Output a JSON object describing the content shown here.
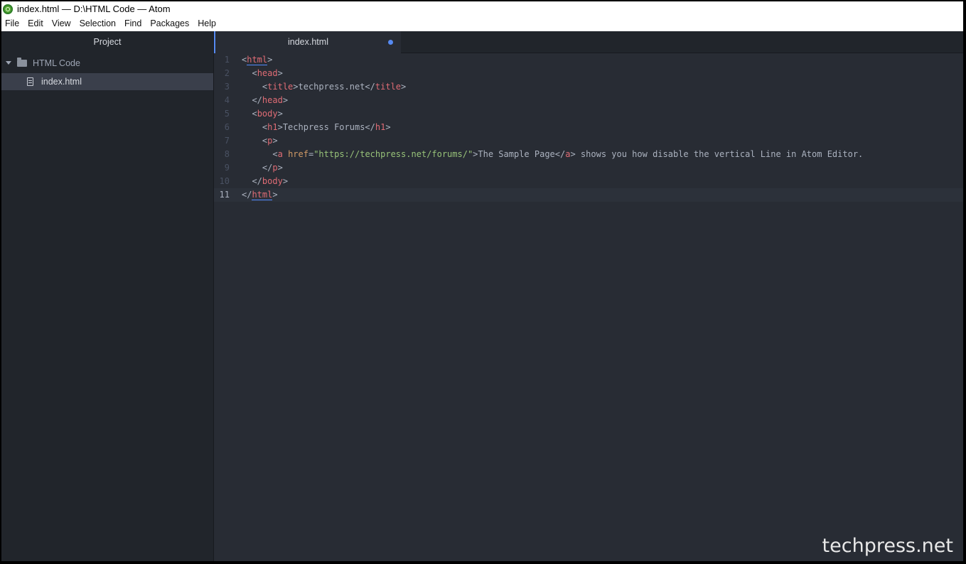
{
  "titlebar": {
    "title": "index.html — D:\\HTML Code — Atom"
  },
  "menu": {
    "items": [
      "File",
      "Edit",
      "View",
      "Selection",
      "Find",
      "Packages",
      "Help"
    ]
  },
  "sidebar": {
    "header": "Project",
    "folder_name": "HTML Code",
    "file_name": "index.html"
  },
  "tabs": [
    {
      "label": "index.html",
      "modified": true
    }
  ],
  "editor": {
    "current_line": 11,
    "lines": [
      {
        "n": "1",
        "text": "<html>"
      },
      {
        "n": "2",
        "text": "  <head>"
      },
      {
        "n": "3",
        "text": "    <title>techpress.net</title>"
      },
      {
        "n": "4",
        "text": "  </head>"
      },
      {
        "n": "5",
        "text": "  <body>"
      },
      {
        "n": "6",
        "text": "    <h1>Techpress Forums</h1>"
      },
      {
        "n": "7",
        "text": "    <p>"
      },
      {
        "n": "8",
        "text": "      <a href=\"https://techpress.net/forums/\">The Sample Page</a> shows you how disable the vertical Line in Atom Editor."
      },
      {
        "n": "9",
        "text": "    </p>"
      },
      {
        "n": "10",
        "text": "  </body>"
      },
      {
        "n": "11",
        "text": "</html>"
      }
    ]
  },
  "colors": {
    "tag": "#e06c75",
    "attribute": "#d19a66",
    "string": "#98c379",
    "text": "#abb2bf",
    "accent": "#568af2"
  },
  "watermark": "techpress.net"
}
